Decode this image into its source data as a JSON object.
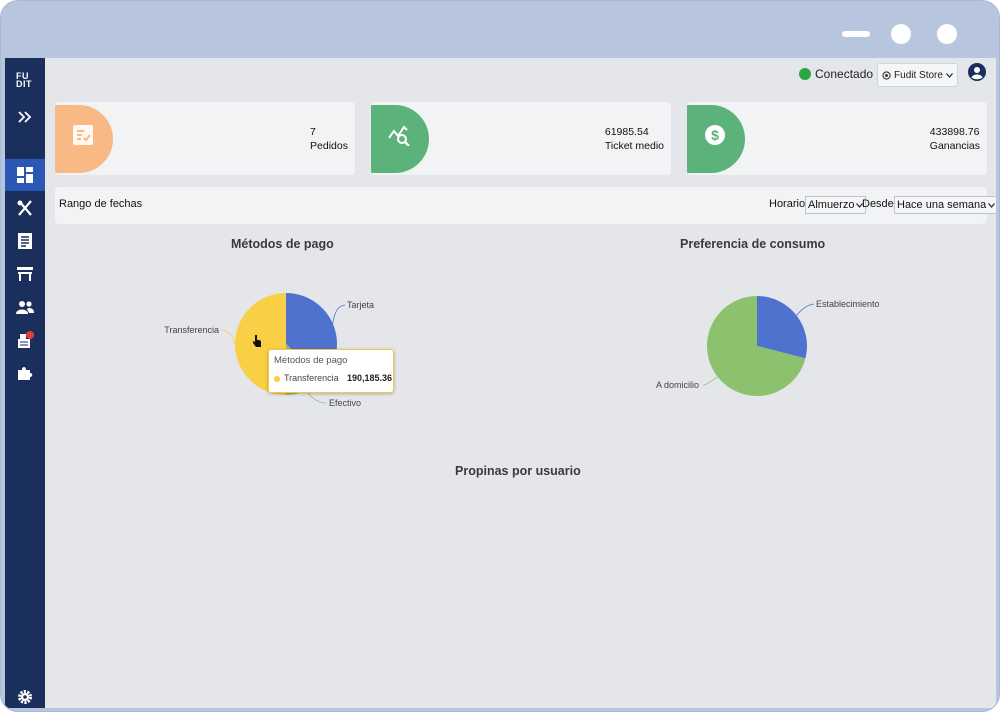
{
  "window": {},
  "sidebar": {
    "logo_text": "FU\nDIT",
    "items": [
      {
        "icon": "chevron-double-right-icon"
      },
      {
        "icon": "dashboard-icon",
        "active": true
      },
      {
        "icon": "utensils-icon"
      },
      {
        "icon": "receipt-icon"
      },
      {
        "icon": "table-icon"
      },
      {
        "icon": "users-icon"
      },
      {
        "icon": "cash-register-icon"
      },
      {
        "icon": "puzzle-icon"
      },
      {
        "icon": "gear-icon"
      }
    ]
  },
  "topbar": {
    "status": "Conectado",
    "status_color": "#28a745",
    "store": "Fudit Store"
  },
  "cards": [
    {
      "value": "7",
      "label": "Pedidos",
      "color": "#f9b984"
    },
    {
      "value": "61985.54",
      "label": "Ticket medio",
      "color": "#5bb27a"
    },
    {
      "value": "433898.76",
      "label": "Ganancias",
      "color": "#5bb27a"
    }
  ],
  "filters": {
    "title": "Rango de fechas",
    "horario_label": "Horario",
    "horario_value": "Almuerzo",
    "desde_label": "Desde",
    "desde_value": "Hace una semana"
  },
  "chart_data": [
    {
      "type": "pie",
      "title": "Métodos de pago",
      "slices": [
        {
          "name": "Tarjeta",
          "share": 0.37,
          "color": "#4f72cf"
        },
        {
          "name": "Efectivo",
          "share": 0.13,
          "color": "#8cc16e"
        },
        {
          "name": "Transferencia",
          "share": 0.5,
          "color": "#f8cf45"
        }
      ],
      "tooltip": {
        "title": "Métodos de pago",
        "name": "Transferencia",
        "value": "190,185.36"
      }
    },
    {
      "type": "pie",
      "title": "Preferencia de consumo",
      "slices": [
        {
          "name": "Establecimiento",
          "share": 0.29,
          "color": "#4f72cf"
        },
        {
          "name": "A domicilio",
          "share": 0.71,
          "color": "#8cc16e"
        }
      ]
    },
    {
      "type": "bar",
      "title": "Propinas por usuario",
      "series": []
    }
  ]
}
